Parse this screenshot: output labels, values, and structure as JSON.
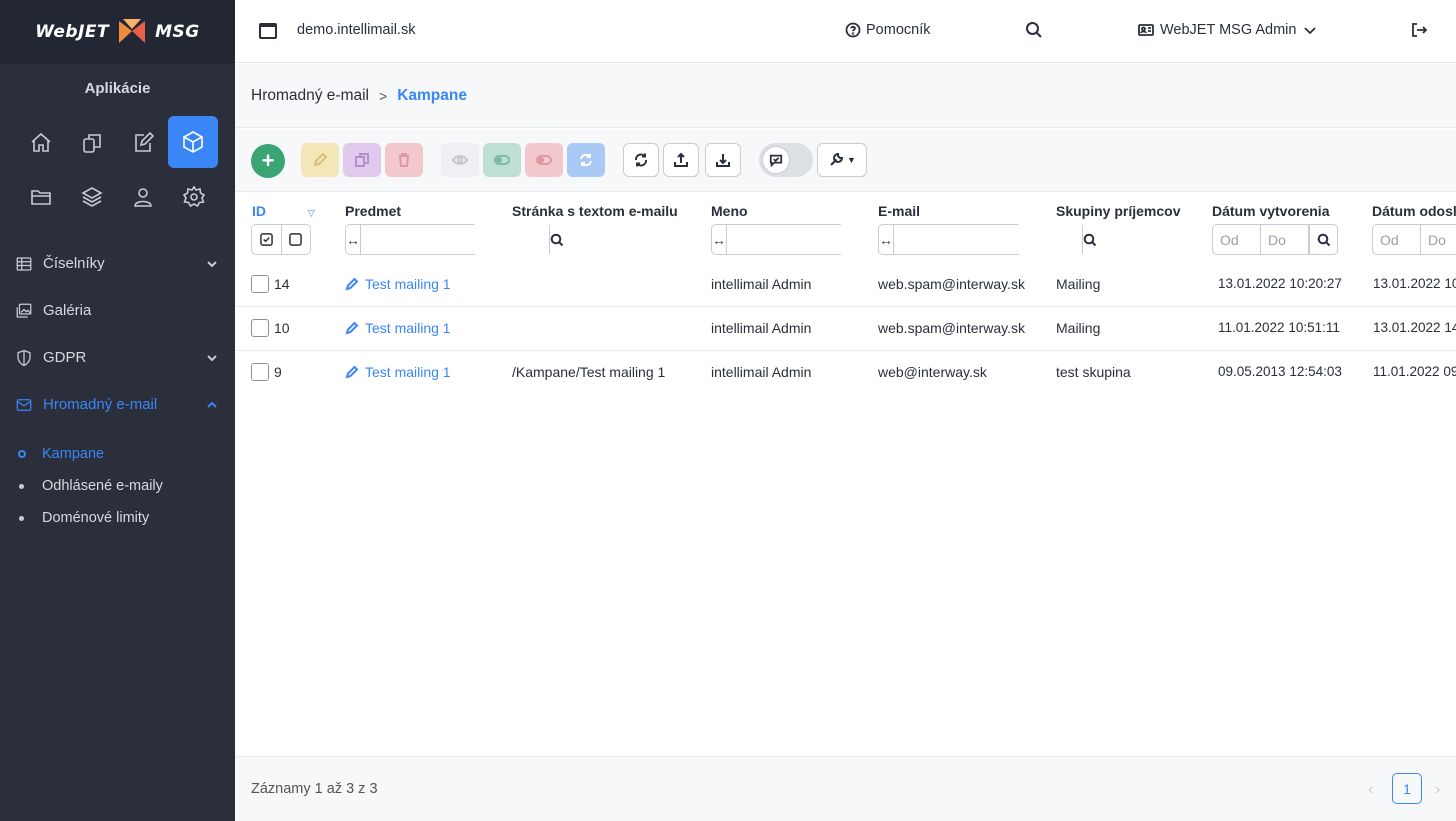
{
  "logo": {
    "left_text": "WebJET",
    "right_text": "MSG"
  },
  "sidebar": {
    "title": "Aplikácie",
    "menu": [
      {
        "label": "Číselníky",
        "icon": "table-icon",
        "expandable": true,
        "open": false
      },
      {
        "label": "Galéria",
        "icon": "gallery-icon",
        "expandable": false,
        "open": false
      },
      {
        "label": "GDPR",
        "icon": "shield-icon",
        "expandable": true,
        "open": false
      },
      {
        "label": "Hromadný e-mail",
        "icon": "mail-icon",
        "expandable": true,
        "open": true
      }
    ],
    "submenu": [
      {
        "label": "Kampane",
        "active": true
      },
      {
        "label": "Odhlásené e-maily",
        "active": false
      },
      {
        "label": "Doménové limity",
        "active": false
      }
    ]
  },
  "header": {
    "domain": "demo.intellimail.sk",
    "help_label": "Pomocník",
    "user_label": "WebJET MSG Admin"
  },
  "breadcrumb": {
    "parent": "Hromadný e-mail",
    "current": "Kampane"
  },
  "table": {
    "columns": {
      "id": "ID",
      "subject": "Predmet",
      "page": "Stránka s textom e-mailu",
      "name": "Meno",
      "email": "E-mail",
      "groups": "Skupiny príjemcov",
      "created": "Dátum vytvorenia",
      "sent": "Dátum odosl"
    },
    "date_from_placeholder": "Od",
    "date_to_placeholder": "Do",
    "rows": [
      {
        "id": "14",
        "subject": "Test mailing 1",
        "page": "",
        "name": "intellimail Admin",
        "email": "web.spam@interway.sk",
        "groups": "Mailing",
        "created": "13.01.2022 10:20:27",
        "sent": "13.01.2022 10"
      },
      {
        "id": "10",
        "subject": "Test mailing 1",
        "page": "",
        "name": "intellimail Admin",
        "email": "web.spam@interway.sk",
        "groups": "Mailing",
        "created": "11.01.2022 10:51:11",
        "sent": "13.01.2022 14"
      },
      {
        "id": "9",
        "subject": "Test mailing 1",
        "page": "/Kampane/Test mailing 1",
        "name": "intellimail Admin",
        "email": "web@interway.sk",
        "groups": "test skupina",
        "created": "09.05.2013 12:54:03",
        "sent": "11.01.2022 09"
      }
    ]
  },
  "footer": {
    "info": "Záznamy 1 až 3 z 3",
    "page": "1"
  },
  "colors": {
    "accent": "#3a86f7",
    "sidebar": "#2b2f3b",
    "add": "#3ba475"
  }
}
